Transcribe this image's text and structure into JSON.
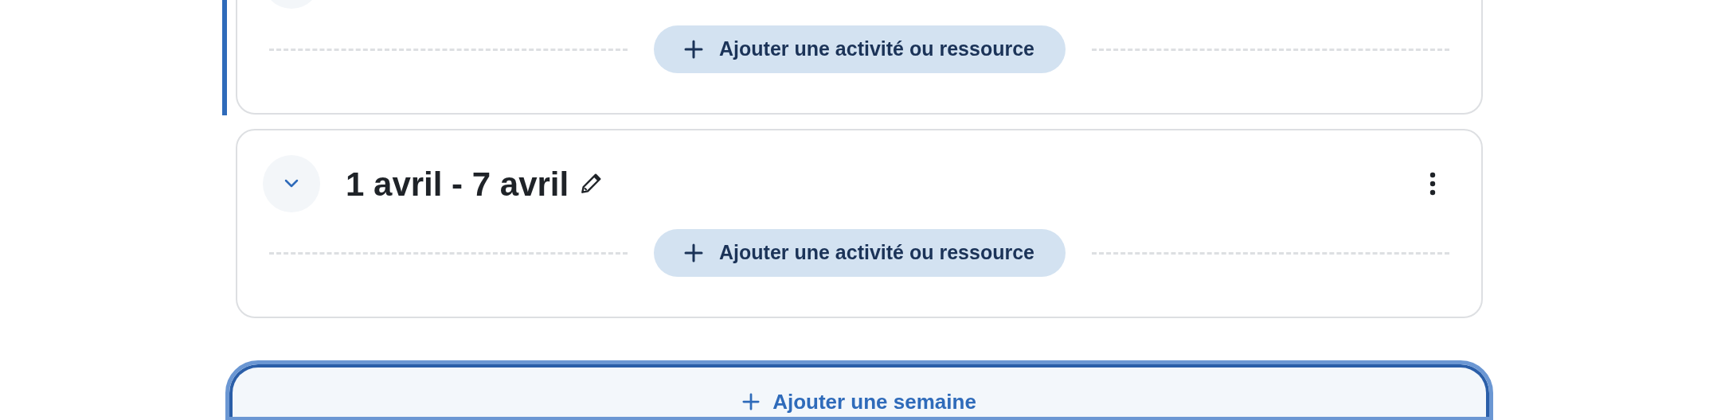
{
  "sections": [
    {
      "selected": true,
      "add_button": "Ajouter une activité ou ressource"
    },
    {
      "selected": false,
      "expanded": true,
      "title": "1 avril - 7 avril",
      "add_button": "Ajouter une activité ou ressource"
    }
  ],
  "add_week_button": "Ajouter une semaine"
}
